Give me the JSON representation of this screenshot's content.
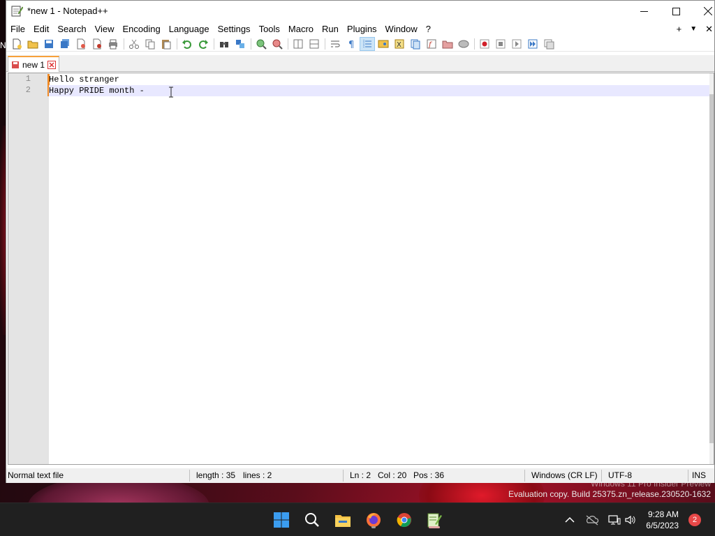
{
  "window": {
    "title": "*new 1 - Notepad++"
  },
  "menu": [
    "File",
    "Edit",
    "Search",
    "View",
    "Encoding",
    "Language",
    "Settings",
    "Tools",
    "Macro",
    "Run",
    "Plugins",
    "Window",
    "?"
  ],
  "menu_right": {
    "add": "+",
    "dropdown": "▼",
    "close": "✕"
  },
  "tabs": [
    {
      "label": "new 1",
      "modified": true
    }
  ],
  "editor": {
    "lines": [
      {
        "number": "1",
        "text": "Hello stranger"
      },
      {
        "number": "2",
        "text": "Happy PRIDE month - "
      }
    ]
  },
  "status": {
    "file_type": "Normal text file",
    "length": "length : 35",
    "lines": "lines : 2",
    "ln": "Ln : 2",
    "col": "Col : 20",
    "pos": "Pos : 36",
    "eol": "Windows (CR LF)",
    "encoding": "UTF-8",
    "mode": "INS"
  },
  "watermark": {
    "line1": "Windows 11 Pro Insider Preview",
    "line2": "Evaluation copy. Build 25375.zn_release.230520-1632"
  },
  "taskbar": {
    "time": "9:28 AM",
    "date": "6/5/2023",
    "notification_count": "2",
    "apps": [
      "start-icon",
      "search-icon",
      "file-explorer-icon",
      "firefox-icon",
      "chrome-icon",
      "notepadpp-icon"
    ]
  },
  "colors": {
    "accent_tab": "#f7a13a",
    "current_line": "#e8e8ff",
    "change_marker": "#f08a24"
  },
  "desktop_edge_text": "N"
}
